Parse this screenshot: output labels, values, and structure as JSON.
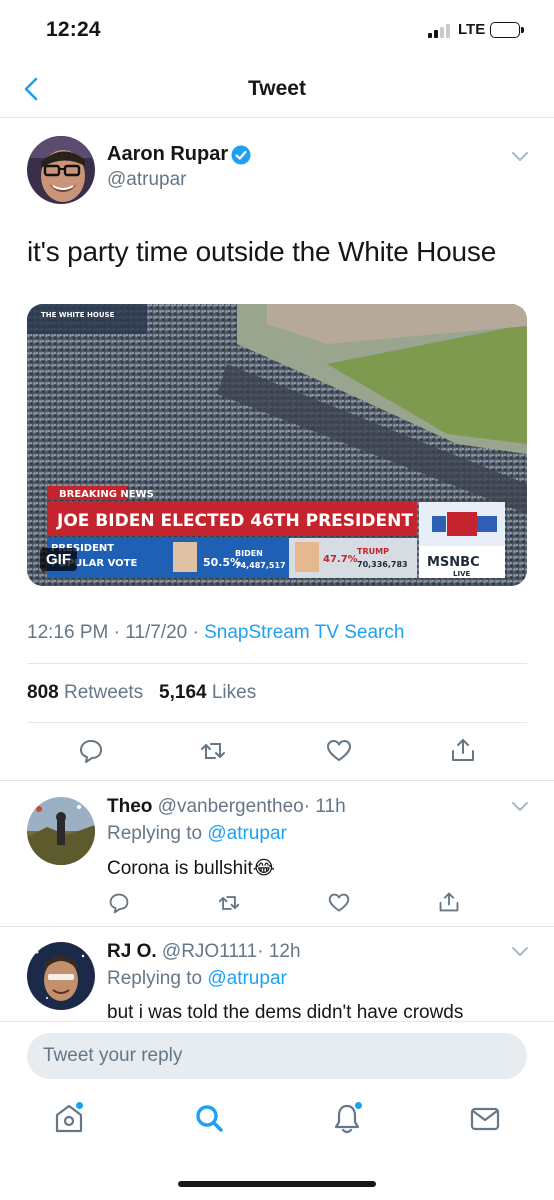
{
  "status_bar": {
    "time": "12:24",
    "network": "LTE"
  },
  "nav": {
    "title": "Tweet",
    "back_icon": "chevron-left-icon"
  },
  "tweet": {
    "author_name": "Aaron Rupar",
    "author_handle": "@atrupar",
    "text": "it's party time outside the White House",
    "media": {
      "badge": "GIF",
      "breaking_label": "BREAKING NEWS",
      "headline": "JOE BIDEN ELECTED 46TH PRESIDENT",
      "lower_left_1": "PRESIDENT",
      "lower_left_2": "POPULAR VOTE",
      "biden_pct": "50.5%",
      "biden_name": "BIDEN",
      "biden_votes": "74,487,517",
      "trump_pct": "47.7%",
      "trump_name": "TRUMP",
      "trump_votes": "70,336,783",
      "network": "MSNBC",
      "live": "LIVE",
      "top_label": "THE WHITE HOUSE"
    },
    "time": "12:16 PM",
    "date": "11/7/20",
    "source": "SnapStream TV Search",
    "retweet_count": "808",
    "retweet_label": "Retweets",
    "like_count": "5,164",
    "like_label": "Likes"
  },
  "replies": [
    {
      "name": "Theo",
      "handle": "@vanbergentheo",
      "time": "· 11h",
      "replying_prefix": "Replying to",
      "replying_to": "@atrupar",
      "text": "Corona is bullshit😂"
    },
    {
      "name": "RJ O.",
      "handle": "@RJO1111",
      "time": "· 12h",
      "replying_prefix": "Replying to",
      "replying_to": "@atrupar",
      "text": "but i was told the dems didn't have crowds"
    }
  ],
  "composer": {
    "placeholder": "Tweet your reply"
  },
  "colors": {
    "accent": "#1da1f2",
    "muted": "#657786",
    "text": "#14171a",
    "divider": "#e1e8ed"
  }
}
